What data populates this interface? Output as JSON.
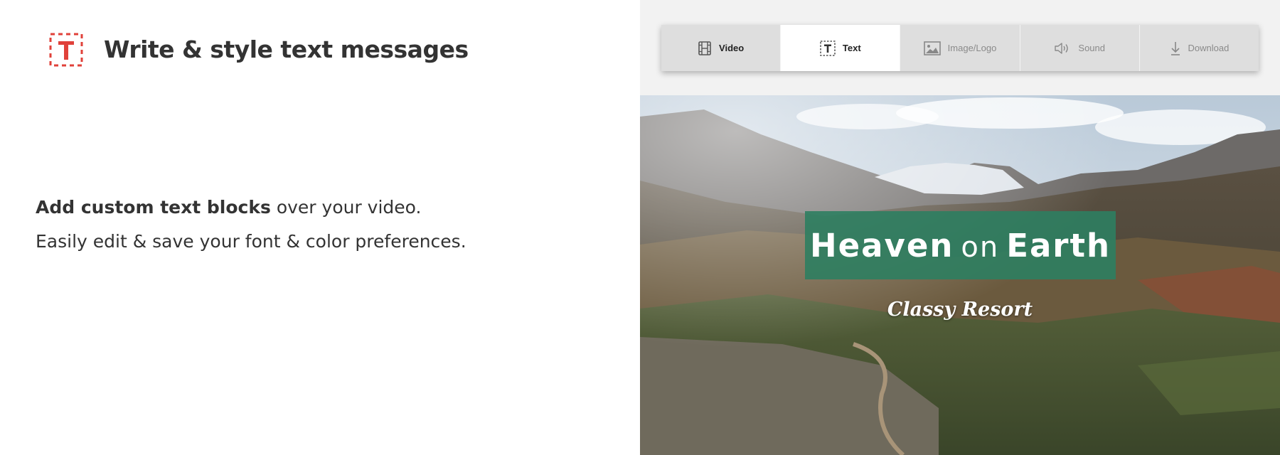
{
  "feature": {
    "icon": "text-box-icon",
    "accent_color": "#e0413a",
    "title": "Write & style text messages",
    "description_bold": "Add custom text blocks",
    "description_rest": " over your video.",
    "description_line2": "Easily edit & save your font & color preferences."
  },
  "toolbar": {
    "active_tab": "Text",
    "tabs": [
      {
        "label": "Video",
        "icon": "film-icon"
      },
      {
        "label": "Text",
        "icon": "text-box-icon"
      },
      {
        "label": "Image/Logo",
        "icon": "image-icon"
      },
      {
        "label": "Sound",
        "icon": "speaker-icon"
      },
      {
        "label": "Download",
        "icon": "download-icon"
      }
    ]
  },
  "preview": {
    "headline_part1": "Heaven",
    "headline_connector": "on",
    "headline_part2": "Earth",
    "subtitle": "Classy Resort",
    "title_box_color": "#2e7e60"
  }
}
